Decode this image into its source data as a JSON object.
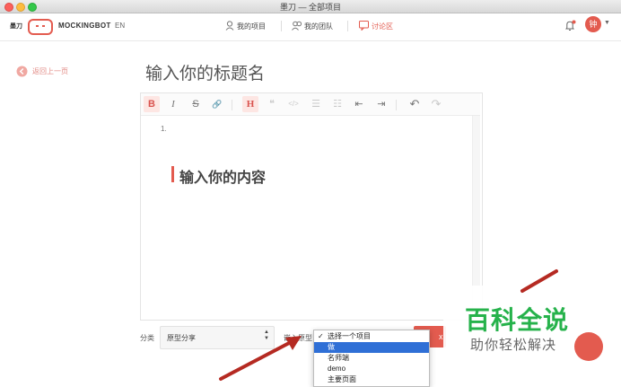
{
  "window": {
    "title": "墨刀 — 全部项目"
  },
  "header": {
    "logo_text": "墨刀",
    "brand": "MOCKINGBOT",
    "lang": "EN",
    "nav": [
      {
        "label": "我的项目",
        "icon": "user-icon",
        "active": false
      },
      {
        "label": "我的团队",
        "icon": "team-icon",
        "active": false
      },
      {
        "label": "讨论区",
        "icon": "chat-icon",
        "active": true
      }
    ],
    "avatar_text": "钟",
    "accent": "#e35b4f"
  },
  "page": {
    "back_label": "返回上一页",
    "title_placeholder": "输入你的标题名",
    "editor": {
      "list_marker": "1.",
      "content_placeholder": "输入你的内容",
      "toolbar": [
        {
          "label": "B",
          "icon": "bold-icon",
          "state": "active"
        },
        {
          "label": "I",
          "icon": "italic-icon",
          "state": "normal"
        },
        {
          "label": "S",
          "icon": "strikethrough-icon",
          "state": "normal"
        },
        {
          "label": "🔗",
          "icon": "link-icon",
          "state": "normal"
        },
        {
          "label": "H",
          "icon": "heading-icon",
          "state": "active"
        },
        {
          "label": "❝",
          "icon": "quote-icon",
          "state": "dim"
        },
        {
          "label": "</>",
          "icon": "code-icon",
          "state": "dim"
        },
        {
          "label": "☰",
          "icon": "unordered-list-icon",
          "state": "dim"
        },
        {
          "label": "☷",
          "icon": "ordered-list-icon",
          "state": "dim"
        },
        {
          "label": "⇤",
          "icon": "outdent-icon",
          "state": "normal"
        },
        {
          "label": "⇥",
          "icon": "indent-icon",
          "state": "normal"
        },
        {
          "label": "↶",
          "icon": "undo-icon",
          "state": "normal"
        },
        {
          "label": "↷",
          "icon": "redo-icon",
          "state": "dim"
        }
      ]
    },
    "category": {
      "label": "分类",
      "value": "原型分享"
    },
    "embed": {
      "label": "嵌入原型",
      "options": [
        {
          "label": "选择一个项目",
          "checked": true,
          "selected": false
        },
        {
          "label": "做",
          "checked": false,
          "selected": true
        },
        {
          "label": "名师端",
          "checked": false,
          "selected": false
        },
        {
          "label": "demo",
          "checked": false,
          "selected": false
        },
        {
          "label": "主要页面",
          "checked": false,
          "selected": false
        }
      ]
    }
  },
  "watermark": {
    "main": "百科全说",
    "sub": "助你轻松解决"
  }
}
